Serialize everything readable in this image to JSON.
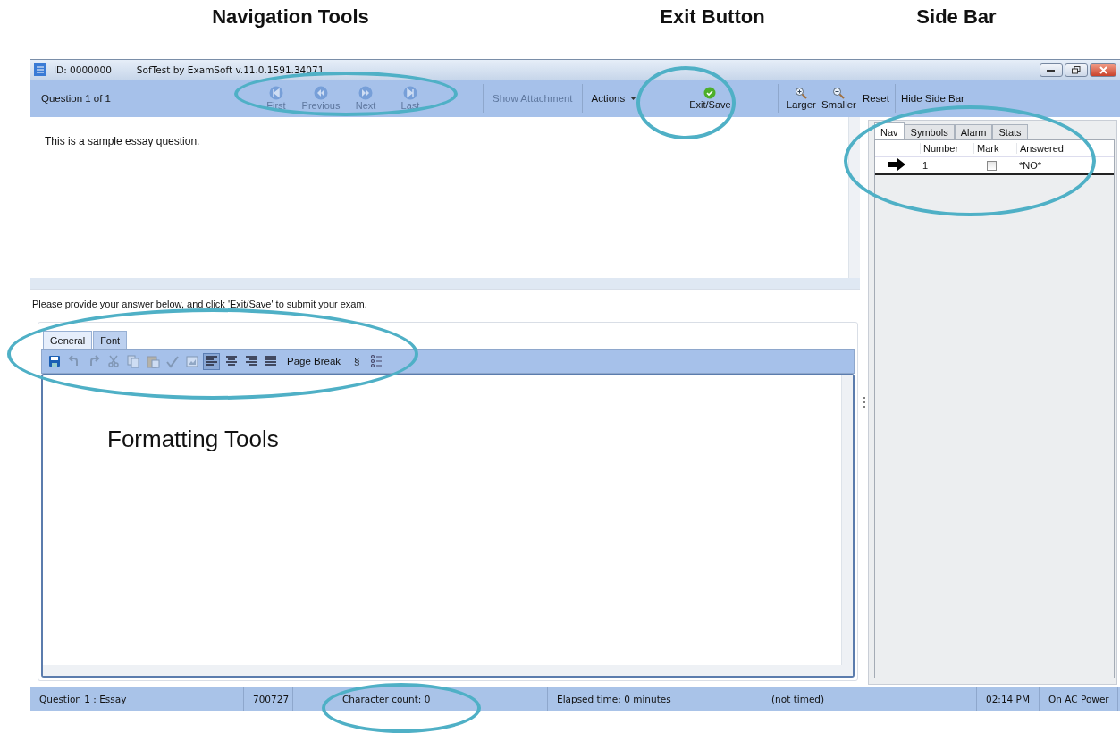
{
  "annotations": {
    "headings": [
      "Navigation Tools",
      "Exit Button",
      "Side Bar"
    ],
    "caption": "Formatting Tools"
  },
  "window": {
    "id": "ID: 0000000",
    "title": "SofTest by ExamSoft v.11.0.1591.34071"
  },
  "toolbar": {
    "question": "Question 1 of 1",
    "nav": [
      {
        "kind": "first",
        "label": "First",
        "disabled": true
      },
      {
        "kind": "previous",
        "label": "Previous",
        "disabled": true
      },
      {
        "kind": "next",
        "label": "Next",
        "disabled": true
      },
      {
        "kind": "last",
        "label": "Last",
        "disabled": true
      }
    ],
    "show_attachment": {
      "label": "Show Attachment",
      "disabled": true
    },
    "actions": "Actions",
    "exit": "Exit/Save",
    "zoom": [
      {
        "kind": "in",
        "label": "Larger"
      },
      {
        "kind": "out",
        "label": "Smaller"
      }
    ],
    "reset": "Reset",
    "hide_sidebar": "Hide Side Bar"
  },
  "question": {
    "text": "This is a sample essay question."
  },
  "instruction": "Please provide your answer below, and click 'Exit/Save' to submit your exam.",
  "editor": {
    "tabs": [
      {
        "label": "General",
        "selected": true
      },
      {
        "label": "Font",
        "selected": false
      }
    ],
    "tools": [
      {
        "kind": "save",
        "disabled": false,
        "selected": false
      },
      {
        "kind": "undo",
        "disabled": true,
        "selected": false
      },
      {
        "kind": "redo",
        "disabled": true,
        "selected": false
      },
      {
        "kind": "cut",
        "disabled": true,
        "selected": false
      },
      {
        "kind": "copy",
        "disabled": true,
        "selected": false
      },
      {
        "kind": "paste",
        "disabled": true,
        "selected": false
      },
      {
        "kind": "spell",
        "disabled": true,
        "selected": false
      },
      {
        "kind": "image",
        "disabled": true,
        "selected": false
      },
      {
        "kind": "align-left",
        "disabled": false,
        "selected": true
      },
      {
        "kind": "align-center",
        "disabled": false,
        "selected": false
      },
      {
        "kind": "align-right",
        "disabled": false,
        "selected": false
      },
      {
        "kind": "justify",
        "disabled": false,
        "selected": false
      },
      {
        "kind": "text",
        "label": "Page Break"
      },
      {
        "kind": "text",
        "label": "§"
      },
      {
        "kind": "list",
        "disabled": false,
        "selected": false
      }
    ]
  },
  "sidebar": {
    "tabs": [
      {
        "label": "Nav",
        "selected": true
      },
      {
        "label": "Symbols",
        "selected": false
      },
      {
        "label": "Alarm",
        "selected": false
      },
      {
        "label": "Stats",
        "selected": false
      }
    ],
    "columns": [
      "Number",
      "Mark",
      "Answered"
    ],
    "rows": [
      {
        "current": true,
        "number": "1",
        "marked": false,
        "answered": "*NO*"
      }
    ]
  },
  "status_bar": [
    "Question 1 : Essay",
    "700727",
    "Character count: 0",
    "Elapsed time:  0 minutes",
    "(not timed)",
    "02:14 PM",
    "On AC Power"
  ]
}
